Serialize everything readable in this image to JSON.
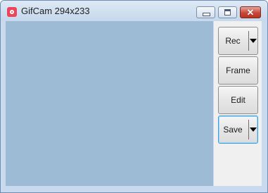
{
  "window": {
    "title": "GifCam 294x233",
    "app_icon": "camera-icon",
    "controls": {
      "minimize_icon": "minimize-icon",
      "maximize_icon": "maximize-icon",
      "close_glyph": "✕"
    }
  },
  "toolbar": {
    "rec_label": "Rec",
    "frame_label": "Frame",
    "edit_label": "Edit",
    "save_label": "Save"
  },
  "colors": {
    "capture_area": "#9ebbd6",
    "frame": "#c9daee",
    "panel": "#f0f0f0",
    "app_icon": "#e8465a",
    "close_button": "#c9473a",
    "focus_border": "#3c9fd9"
  }
}
